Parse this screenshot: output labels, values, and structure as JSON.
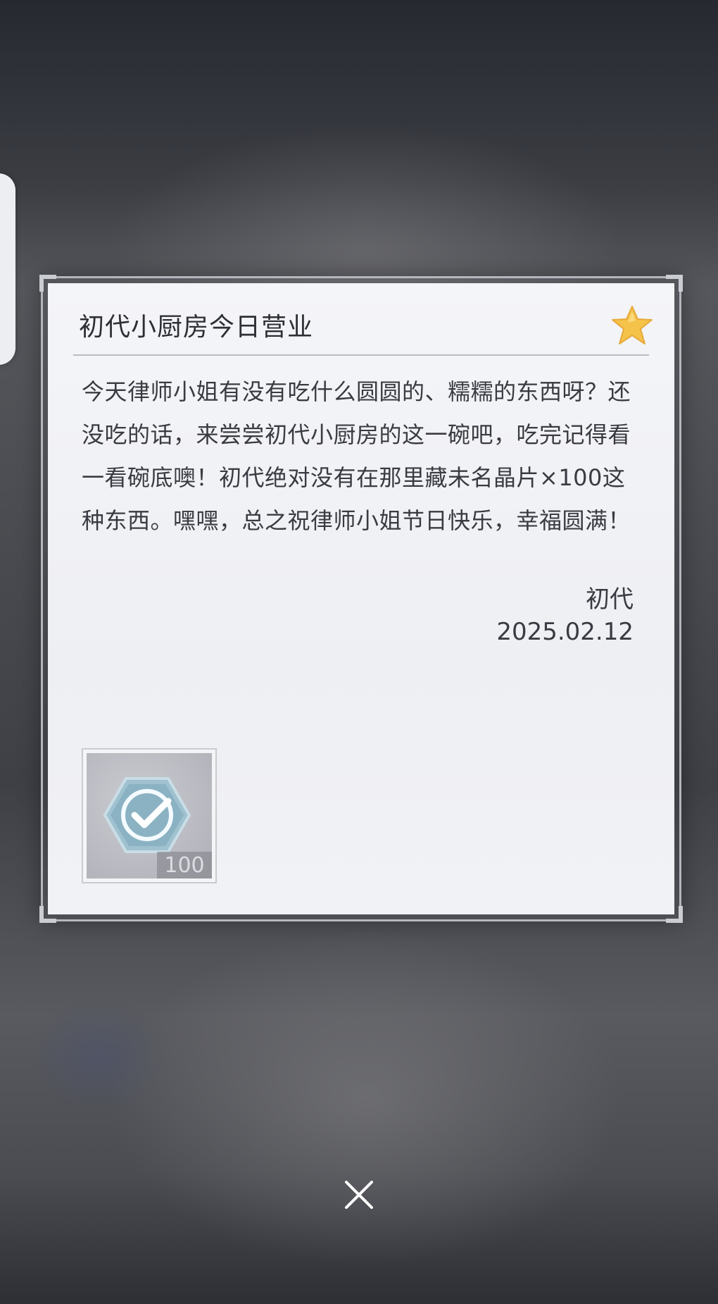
{
  "letter": {
    "title": "初代小厨房今日营业",
    "body": "今天律师小姐有没有吃什么圆圆的、糯糯的东西呀？还没吃的话，来尝尝初代小厨房的这一碗吧，吃完记得看一看碗底噢！初代绝对没有在那里藏未名晶片×100这种东西。嘿嘿，总之祝律师小姐节日快乐，幸福圆满！",
    "sender": "初代",
    "date": "2025.02.12"
  },
  "attachment": {
    "icon": "hexagon-check-icon",
    "quantity": "100"
  },
  "icons": {
    "favorite": "star-icon",
    "close": "close-icon"
  },
  "colors": {
    "star": "#f5c24a",
    "card": "#f1f2f5",
    "text": "#3a3b42"
  }
}
